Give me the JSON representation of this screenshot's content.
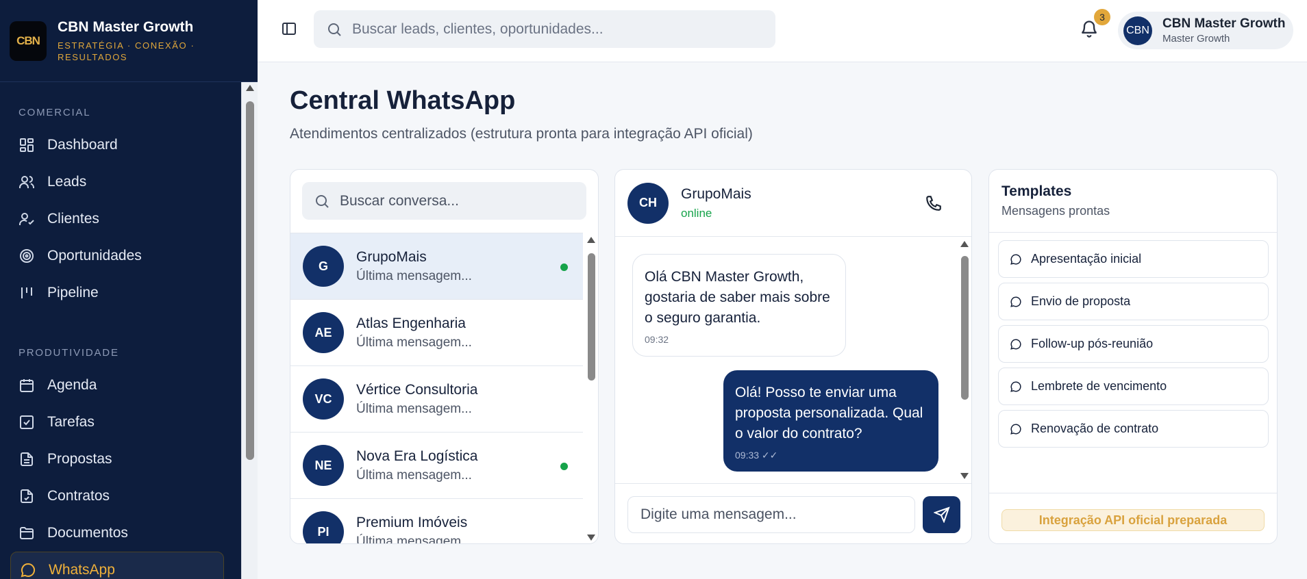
{
  "brand": {
    "logo_text": "CBN",
    "title": "CBN Master Growth",
    "subtitle": "ESTRATÉGIA · CONEXÃO · RESULTADOS"
  },
  "sidebar": {
    "sections": [
      {
        "label": "COMERCIAL",
        "items": [
          {
            "label": "Dashboard",
            "icon": "dashboard-icon"
          },
          {
            "label": "Leads",
            "icon": "users-icon"
          },
          {
            "label": "Clientes",
            "icon": "user-check-icon"
          },
          {
            "label": "Oportunidades",
            "icon": "target-icon"
          },
          {
            "label": "Pipeline",
            "icon": "kanban-icon"
          }
        ]
      },
      {
        "label": "PRODUTIVIDADE",
        "items": [
          {
            "label": "Agenda",
            "icon": "calendar-icon"
          },
          {
            "label": "Tarefas",
            "icon": "checkbox-icon"
          },
          {
            "label": "Propostas",
            "icon": "file-text-icon"
          },
          {
            "label": "Contratos",
            "icon": "file-check-icon"
          },
          {
            "label": "Documentos",
            "icon": "folder-icon"
          },
          {
            "label": "WhatsApp",
            "icon": "chat-icon",
            "active": true
          }
        ]
      }
    ]
  },
  "topbar": {
    "search_placeholder": "Buscar leads, clientes, oportunidades...",
    "notification_count": "3",
    "user": {
      "initials": "CBN",
      "name": "CBN Master Growth",
      "role": "Master Growth"
    }
  },
  "page": {
    "title": "Central WhatsApp",
    "subtitle": "Atendimentos centralizados (estrutura pronta para integração API oficial)"
  },
  "conversations": {
    "search_placeholder": "Buscar conversa...",
    "items": [
      {
        "initials": "G",
        "name": "GrupoMais",
        "last": "Última mensagem...",
        "online": true,
        "selected": true
      },
      {
        "initials": "AE",
        "name": "Atlas Engenharia",
        "last": "Última mensagem...",
        "online": false
      },
      {
        "initials": "VC",
        "name": "Vértice Consultoria",
        "last": "Última mensagem...",
        "online": false
      },
      {
        "initials": "NE",
        "name": "Nova Era Logística",
        "last": "Última mensagem...",
        "online": true
      },
      {
        "initials": "PI",
        "name": "Premium Imóveis",
        "last": "Última mensagem...",
        "online": false
      }
    ]
  },
  "chat": {
    "initials": "CH",
    "name": "GrupoMais",
    "status": "online",
    "messages": [
      {
        "direction": "in",
        "text": "Olá CBN Master Growth, gostaria de saber mais sobre o seguro garantia.",
        "time": "09:32"
      },
      {
        "direction": "out",
        "text": "Olá! Posso te enviar uma proposta personalizada. Qual o valor do contrato?",
        "time": "09:33 ✓✓"
      }
    ],
    "composer_placeholder": "Digite uma mensagem..."
  },
  "templates": {
    "title": "Templates",
    "subtitle": "Mensagens prontas",
    "items": [
      "Apresentação inicial",
      "Envio de proposta",
      "Follow-up pós-reunião",
      "Lembrete de vencimento",
      "Renovação de contrato"
    ],
    "footer_badge": "Integração API oficial preparada"
  },
  "colors": {
    "sidebar_bg": "#0d1d3d",
    "accent_gold": "#f0b13a",
    "primary_navy": "#123068",
    "online_green": "#16a34a"
  }
}
